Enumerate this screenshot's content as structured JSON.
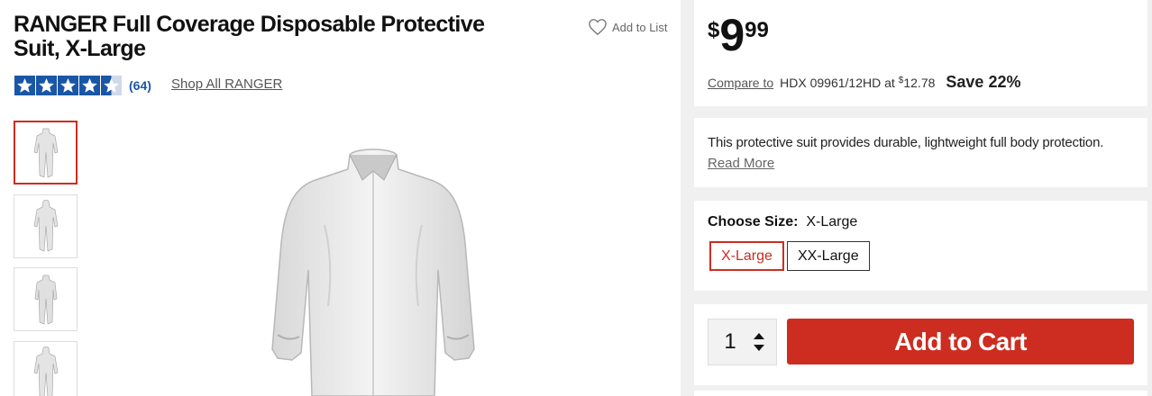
{
  "product": {
    "brand": "RANGER",
    "title": "Full Coverage Disposable Protective Suit, X-Large",
    "add_to_list": "Add to List",
    "rating": 4.5,
    "review_count": "(64)",
    "shop_all": "Shop All RANGER"
  },
  "price": {
    "currency": "$",
    "dollars": "9",
    "cents": "99"
  },
  "compare": {
    "link": "Compare to",
    "product": "HDX 09961/12HD at",
    "currency": "$",
    "amount": "12.78",
    "save": "Save 22%"
  },
  "description": {
    "text": "This protective suit provides durable, lightweight full body protection.",
    "read_more": "Read More"
  },
  "size": {
    "label": "Choose Size:",
    "selected": "X-Large",
    "options": [
      "X-Large",
      "XX-Large"
    ]
  },
  "cart": {
    "quantity": "1",
    "button": "Add to Cart"
  },
  "colors": {
    "accent": "#cc2d20",
    "star": "#1a56a6",
    "panel_bg": "#f0f0f0"
  },
  "icons": [
    "heart-icon",
    "star-icon",
    "chevron-up-icon",
    "chevron-down-icon"
  ]
}
